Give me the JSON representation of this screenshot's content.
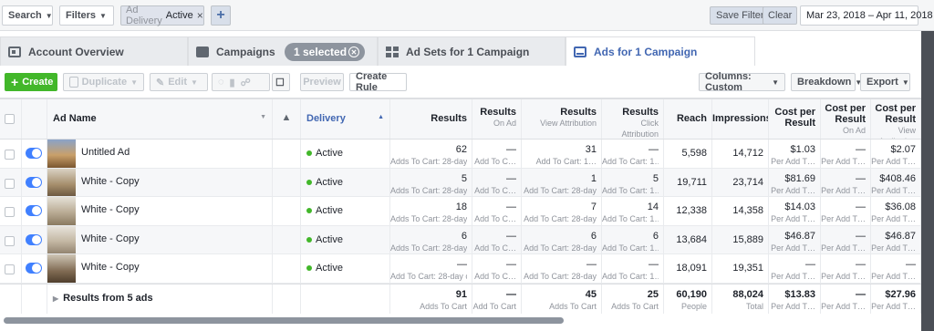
{
  "topbar": {
    "search_label": "Search",
    "filters_label": "Filters",
    "chip_key": "Ad Delivery",
    "chip_value": "Active",
    "save_filter_label": "Save Filter",
    "clear_label": "Clear",
    "date_range": "Mar 23, 2018 – Apr 11, 2018"
  },
  "tabs": [
    {
      "label": "Account Overview",
      "icon": "account-overview-icon"
    },
    {
      "label": "Campaigns",
      "icon": "campaigns-folder-icon",
      "badge": "1 selected"
    },
    {
      "label": "Ad Sets for 1 Campaign",
      "icon": "adsets-grid-icon"
    },
    {
      "label": "Ads for 1 Campaign",
      "icon": "ad-icon",
      "active": true
    }
  ],
  "toolbar": {
    "create_label": "Create",
    "duplicate_label": "Duplicate",
    "edit_label": "Edit",
    "preview_label": "Preview",
    "create_rule_label": "Create Rule",
    "columns_label": "Columns: Custom",
    "breakdown_label": "Breakdown",
    "export_label": "Export"
  },
  "table": {
    "headers": {
      "ad_name": "Ad Name",
      "delivery": "Delivery",
      "results": "Results",
      "results_on_ad": {
        "title": "Results",
        "sub": "On Ad"
      },
      "results_view": {
        "title": "Results",
        "sub": "View Attribution"
      },
      "results_click": {
        "title": "Results",
        "sub": "Click Attribution"
      },
      "reach": "Reach",
      "impressions": "Impressions",
      "cpr": {
        "title": "Cost per Result"
      },
      "cpr_on_ad": {
        "title": "Cost per Result",
        "sub": "On Ad"
      },
      "cpr_view": {
        "title": "Cost per Result",
        "sub": "View Attribution"
      }
    },
    "rows": [
      {
        "name": "Untitled Ad",
        "delivery": "Active",
        "results": "62",
        "results_sub": "Adds To Cart: 28-day",
        "on_ad": "—",
        "on_ad_sub": "Add To C…",
        "view": "31",
        "view_sub": "Add To Cart: 1…",
        "click": "—",
        "click_sub": "Add To Cart: 1…",
        "reach": "5,598",
        "impressions": "14,712",
        "cpr": "$1.03",
        "cpr_sub": "Per Add T…",
        "cpr_on_ad": "—",
        "cpr_on_ad_sub": "Per Add T…",
        "cpr_view": "$2.07",
        "cpr_view_sub": "Per Add T…"
      },
      {
        "name": "White - Copy",
        "delivery": "Active",
        "results": "5",
        "results_sub": "Adds To Cart: 28-day",
        "on_ad": "—",
        "on_ad_sub": "Add To C…",
        "view": "1",
        "view_sub": "Add To Cart: 28-day",
        "click": "5",
        "click_sub": "Add To Cart: 1…",
        "reach": "19,711",
        "impressions": "23,714",
        "cpr": "$81.69",
        "cpr_sub": "Per Add T…",
        "cpr_on_ad": "—",
        "cpr_on_ad_sub": "Per Add T…",
        "cpr_view": "$408.46",
        "cpr_view_sub": "Per Add T…"
      },
      {
        "name": "White - Copy",
        "delivery": "Active",
        "results": "18",
        "results_sub": "Adds To Cart: 28-day",
        "on_ad": "—",
        "on_ad_sub": "Add To C…",
        "view": "7",
        "view_sub": "Add To Cart: 28-day",
        "click": "14",
        "click_sub": "Add To Cart: 1…",
        "reach": "12,338",
        "impressions": "14,358",
        "cpr": "$14.03",
        "cpr_sub": "Per Add T…",
        "cpr_on_ad": "—",
        "cpr_on_ad_sub": "Per Add T…",
        "cpr_view": "$36.08",
        "cpr_view_sub": "Per Add T…"
      },
      {
        "name": "White - Copy",
        "delivery": "Active",
        "results": "6",
        "results_sub": "Adds To Cart: 28-day",
        "on_ad": "—",
        "on_ad_sub": "Add To C…",
        "view": "6",
        "view_sub": "Add To Cart: 28-day",
        "click": "6",
        "click_sub": "Add To Cart: 1…",
        "reach": "13,684",
        "impressions": "15,889",
        "cpr": "$46.87",
        "cpr_sub": "Per Add T…",
        "cpr_on_ad": "—",
        "cpr_on_ad_sub": "Per Add T…",
        "cpr_view": "$46.87",
        "cpr_view_sub": "Per Add T…"
      },
      {
        "name": "White - Copy",
        "delivery": "Active",
        "results": "—",
        "results_sub": "Add To Cart: 28-day c…",
        "on_ad": "—",
        "on_ad_sub": "Add To C…",
        "view": "—",
        "view_sub": "Add To Cart: 28-day",
        "click": "—",
        "click_sub": "Add To Cart: 1…",
        "reach": "18,091",
        "impressions": "19,351",
        "cpr": "—",
        "cpr_sub": "Per Add T…",
        "cpr_on_ad": "—",
        "cpr_on_ad_sub": "Per Add T…",
        "cpr_view": "—",
        "cpr_view_sub": "Per Add T…"
      }
    ],
    "summary": {
      "label": "Results from 5 ads",
      "results": "91",
      "results_sub": "Adds To Cart",
      "on_ad": "—",
      "on_ad_sub": "Add To Cart",
      "view": "45",
      "view_sub": "Adds To Cart",
      "click": "25",
      "click_sub": "Adds To Cart",
      "reach": "60,190",
      "reach_sub": "People",
      "impressions": "88,024",
      "impressions_sub": "Total",
      "cpr": "$13.83",
      "cpr_sub": "Per Add T…",
      "cpr_on_ad": "—",
      "cpr_on_ad_sub": "Per Add T…",
      "cpr_view": "$27.96",
      "cpr_view_sub": "Per Add T…"
    }
  },
  "colors": {
    "accent": "#4267b2",
    "create_green": "#42b72a",
    "toggle_on": "#4080ff",
    "active_dot": "#42b72a"
  }
}
